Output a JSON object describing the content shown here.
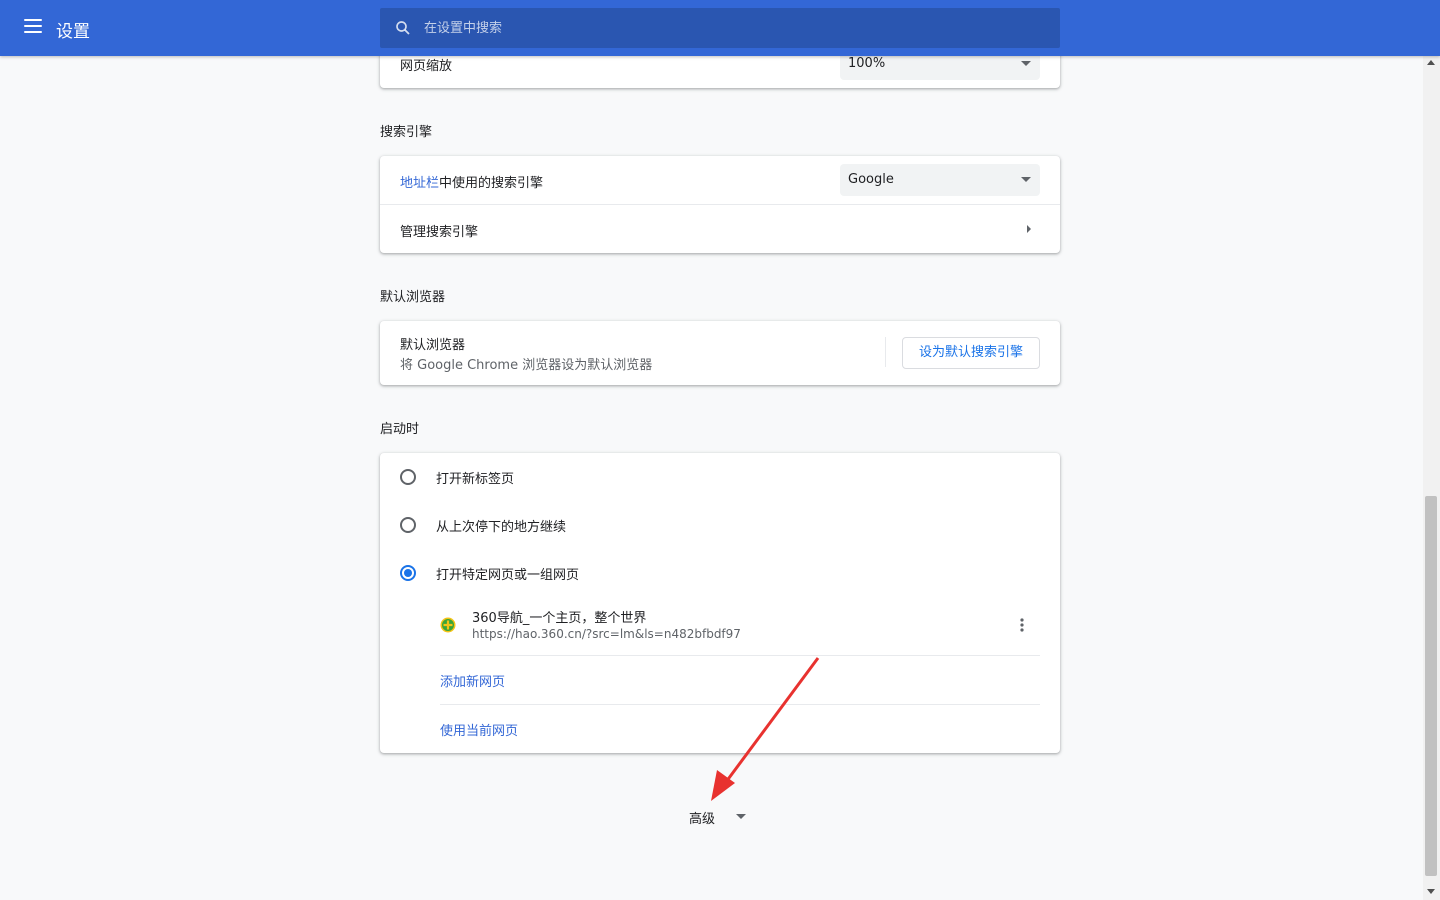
{
  "header": {
    "title": "设置",
    "search_placeholder": "在设置中搜索"
  },
  "appearance": {
    "zoom_label": "网页缩放",
    "zoom_value": "100%"
  },
  "search_engine": {
    "section_title": "搜索引擎",
    "address_bar_link": "地址栏",
    "address_bar_rest": "中使用的搜索引擎",
    "engine_value": "Google",
    "manage_label": "管理搜索引擎"
  },
  "default_browser": {
    "section_title": "默认浏览器",
    "row_title": "默认浏览器",
    "row_subtitle": "将 Google Chrome 浏览器设为默认浏览器",
    "button_label": "设为默认搜索引擎"
  },
  "startup": {
    "section_title": "启动时",
    "options": [
      {
        "label": "打开新标签页",
        "checked": false
      },
      {
        "label": "从上次停下的地方继续",
        "checked": false
      },
      {
        "label": "打开特定网页或一组网页",
        "checked": true
      }
    ],
    "page": {
      "title": "360导航_一个主页，整个世界",
      "url": "https://hao.360.cn/?src=lm&ls=n482bfbdf97"
    },
    "add_page": "添加新网页",
    "use_current": "使用当前网页"
  },
  "advanced": {
    "label": "高级"
  },
  "colors": {
    "header_bg": "#3367d6",
    "search_bg": "#2a56b1",
    "accent": "#1a73e8",
    "annotation_arrow": "#e8322f"
  }
}
